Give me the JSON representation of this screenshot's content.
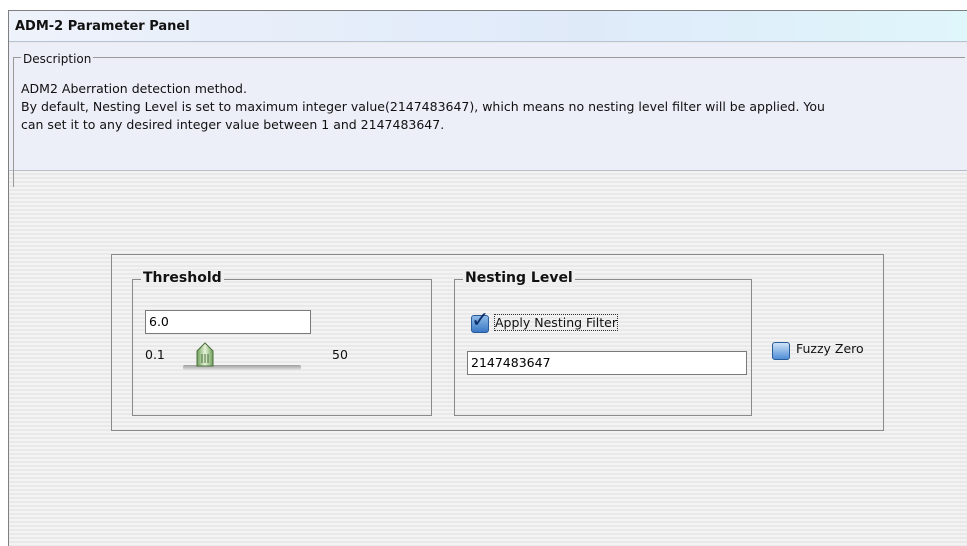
{
  "window": {
    "title": "ADM-2 Parameter Panel"
  },
  "description": {
    "legend": "Description",
    "lines": [
      "ADM2 Aberration detection method.",
      "By default, Nesting Level is set to maximum integer value(2147483647), which means no nesting level filter will be applied. You",
      "can set it to any desired integer value between 1 and 2147483647."
    ]
  },
  "threshold": {
    "legend": "Threshold",
    "value": "6.0",
    "slider_min_label": "0.1",
    "slider_max_label": "50",
    "slider_min": 0.1,
    "slider_max": 50,
    "slider_value": 6.0
  },
  "nesting": {
    "legend": "Nesting Level",
    "apply_filter_label": "Apply Nesting Filter",
    "apply_filter_checked": true,
    "value": "2147483647"
  },
  "fuzzy_zero": {
    "label": "Fuzzy Zero",
    "checked": false
  },
  "colors": {
    "title_gradient": "#dff6fb",
    "description_bg": "#eceef8",
    "checkbox_blue": "#3a78c4"
  },
  "icons": {
    "checkbox_checked": "check-mark-icon",
    "slider_thumb": "slider-thumb-icon"
  }
}
